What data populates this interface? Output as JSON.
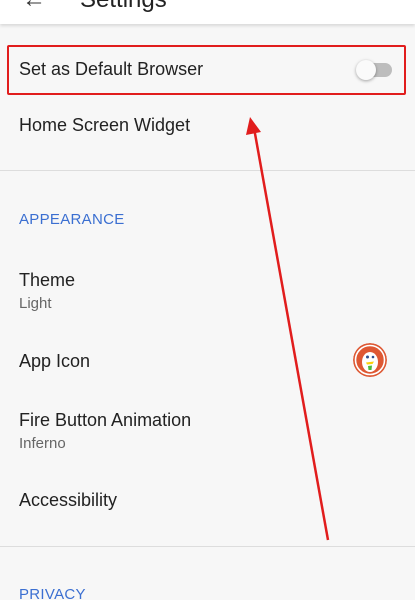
{
  "appbar": {
    "title": "Settings"
  },
  "general": {
    "default_browser": {
      "label": "Set as Default Browser",
      "enabled": false
    },
    "home_widget": {
      "label": "Home Screen Widget"
    }
  },
  "appearance": {
    "header": "APPEARANCE",
    "theme": {
      "label": "Theme",
      "value": "Light"
    },
    "app_icon": {
      "label": "App Icon",
      "icon": "duckduckgo-logo-icon"
    },
    "fire_button": {
      "label": "Fire Button Animation",
      "value": "Inferno"
    },
    "accessibility": {
      "label": "Accessibility"
    }
  },
  "privacy": {
    "header": "PRIVACY"
  },
  "annotation": {
    "highlight_color": "#e11d1d",
    "arrow_color": "#e11d1d"
  },
  "colors": {
    "section_header": "#3b6fd1",
    "background": "#f7f7f7"
  }
}
